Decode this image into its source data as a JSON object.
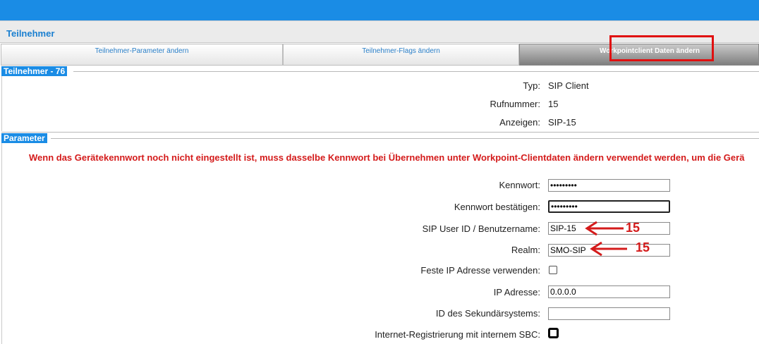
{
  "header": {
    "title": "Teilnehmer"
  },
  "tabs": [
    {
      "label": "Teilnehmer-Parameter ändern"
    },
    {
      "label": "Teilnehmer-Flags ändern"
    },
    {
      "label": "Workpointclient Daten ändern"
    }
  ],
  "section_subscriber": {
    "title": "Teilnehmer - 76",
    "rows": [
      {
        "label": "Typ:",
        "value": "SIP Client"
      },
      {
        "label": "Rufnummer:",
        "value": "15"
      },
      {
        "label": "Anzeigen:",
        "value": "SIP-15"
      }
    ]
  },
  "section_parameter": {
    "title": "Parameter",
    "warning": "Wenn das Gerätekennwort noch nicht eingestellt ist, muss dasselbe Kennwort bei Übernehmen unter Workpoint-Clientdaten ändern verwendet werden, um die Gerä",
    "fields": {
      "password": {
        "label": "Kennwort:",
        "value": "•••••••••"
      },
      "password_confirm": {
        "label": "Kennwort bestätigen:",
        "value": "•••••••••"
      },
      "sip_user": {
        "label": "SIP User ID / Benutzername:",
        "value": "SIP-15"
      },
      "realm": {
        "label": "Realm:",
        "value": "SMO-SIP"
      },
      "fixed_ip": {
        "label": "Feste IP Adresse verwenden:"
      },
      "ip": {
        "label": "IP Adresse:",
        "value": "0.0.0.0"
      },
      "secondary_id": {
        "label": "ID des Sekundärsystems:",
        "value": ""
      },
      "internet_reg": {
        "label": "Internet-Registrierung mit internem SBC:"
      }
    }
  },
  "annotations": {
    "sip_user_note": "15",
    "realm_note": "15"
  },
  "colors": {
    "accent": "#1a8ce5",
    "warning": "#d41b1b",
    "highlight": "#e01010"
  }
}
